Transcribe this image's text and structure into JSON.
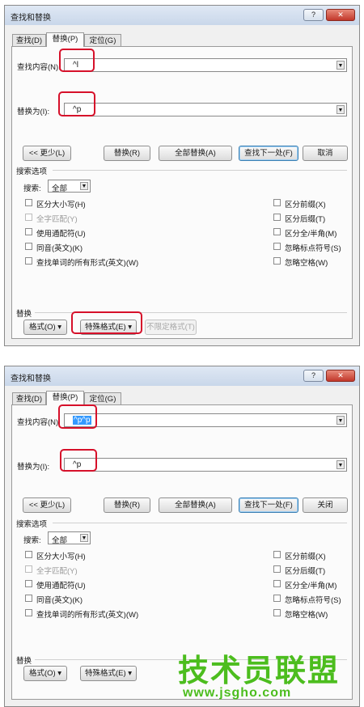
{
  "dialogs": [
    {
      "title": "查找和替换",
      "help_label": "?",
      "close_label": "✕",
      "tabs": [
        "查找(D)",
        "替换(P)",
        "定位(G)"
      ],
      "find_label": "查找内容(N):",
      "find_value": "^l",
      "replace_label": "替换为(I):",
      "replace_value": "^p",
      "buttons": {
        "less": "<< 更少(L)",
        "replace": "替换(R)",
        "replace_all": "全部替换(A)",
        "find_next": "查找下一处(F)",
        "cancel": "取消"
      },
      "options_title": "搜索选项",
      "search_label": "搜索:",
      "search_value": "全部",
      "left_options": [
        "区分大小写(H)",
        "全字匹配(Y)",
        "使用通配符(U)",
        "同音(英文)(K)",
        "查找单词的所有形式(英文)(W)"
      ],
      "right_options": [
        "区分前缀(X)",
        "区分后缀(T)",
        "区分全/半角(M)",
        "忽略标点符号(S)",
        "忽略空格(W)"
      ],
      "replace_section": "替换",
      "bottom_buttons": {
        "format": "格式(O) ▾",
        "special": "特殊格式(E) ▾",
        "no_format": "不限定格式(T)"
      }
    },
    {
      "title": "查找和替换",
      "help_label": "?",
      "close_label": "✕",
      "tabs": [
        "查找(D)",
        "替换(P)",
        "定位(G)"
      ],
      "find_label": "查找内容(N):",
      "find_value": "^p^p",
      "replace_label": "替换为(I):",
      "replace_value": "^p",
      "buttons": {
        "less": "<< 更少(L)",
        "replace": "替换(R)",
        "replace_all": "全部替换(A)",
        "find_next": "查找下一处(F)",
        "cancel": "关闭"
      },
      "options_title": "搜索选项",
      "search_label": "搜索:",
      "search_value": "全部",
      "left_options": [
        "区分大小写(H)",
        "全字匹配(Y)",
        "使用通配符(U)",
        "同音(英文)(K)",
        "查找单词的所有形式(英文)(W)"
      ],
      "right_options": [
        "区分前缀(X)",
        "区分后缀(T)",
        "区分全/半角(M)",
        "忽略标点符号(S)",
        "忽略空格(W)"
      ],
      "replace_section": "替换",
      "bottom_buttons": {
        "format": "格式(O) ▾",
        "special": "特殊格式(E) ▾"
      }
    }
  ],
  "watermark": {
    "main": "技术员联盟",
    "url": "www.jsgho.com"
  },
  "colors": {
    "highlight": "#d6102a",
    "watermark": "#4cbd1e",
    "selection": "#3399ff"
  }
}
